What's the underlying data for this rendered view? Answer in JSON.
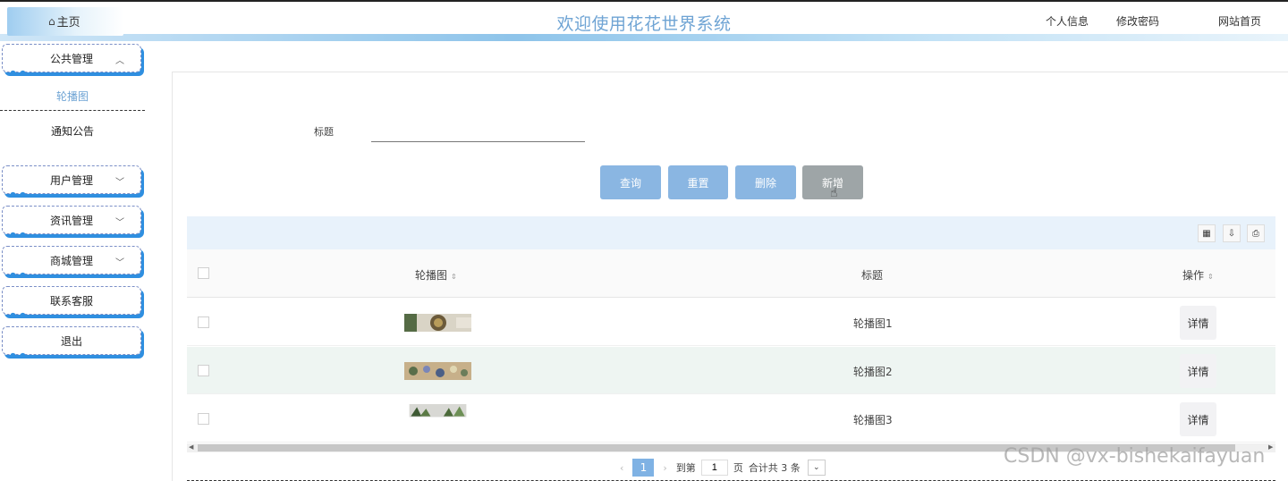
{
  "header": {
    "home": "主页",
    "title": "欢迎使用花花世界系统",
    "links": [
      "个人信息",
      "修改密码",
      "网站首页"
    ]
  },
  "sidebar": {
    "groups": [
      {
        "label": "公共管理",
        "expanded": true,
        "children": [
          "轮播图",
          "通知公告"
        ],
        "active_child": "轮播图"
      },
      {
        "label": "用户管理",
        "expanded": false
      },
      {
        "label": "资讯管理",
        "expanded": false
      },
      {
        "label": "商城管理",
        "expanded": false
      },
      {
        "label": "联系客服"
      },
      {
        "label": "退出"
      }
    ]
  },
  "search": {
    "label": "标题",
    "value": ""
  },
  "actions": {
    "query": "查询",
    "reset": "重置",
    "delete": "删除",
    "add": "新增"
  },
  "table": {
    "columns": [
      "轮播图",
      "标题",
      "操作"
    ],
    "rows": [
      {
        "title": "轮播图1",
        "action": "详情"
      },
      {
        "title": "轮播图2",
        "action": "详情"
      },
      {
        "title": "轮播图3",
        "action": "详情"
      }
    ]
  },
  "pagination": {
    "current_page": "1",
    "goto_label": "到第",
    "goto_value": "1",
    "page_unit": "页",
    "total_text": "合计共 3 条"
  },
  "watermark": "CSDN @vx-bishekaifayuan",
  "colors": {
    "accent": "#8ab6e2",
    "title": "#6fa4d4",
    "add_button": "#9ea5a7",
    "sidebar_shadow": "#2f8fe0"
  }
}
